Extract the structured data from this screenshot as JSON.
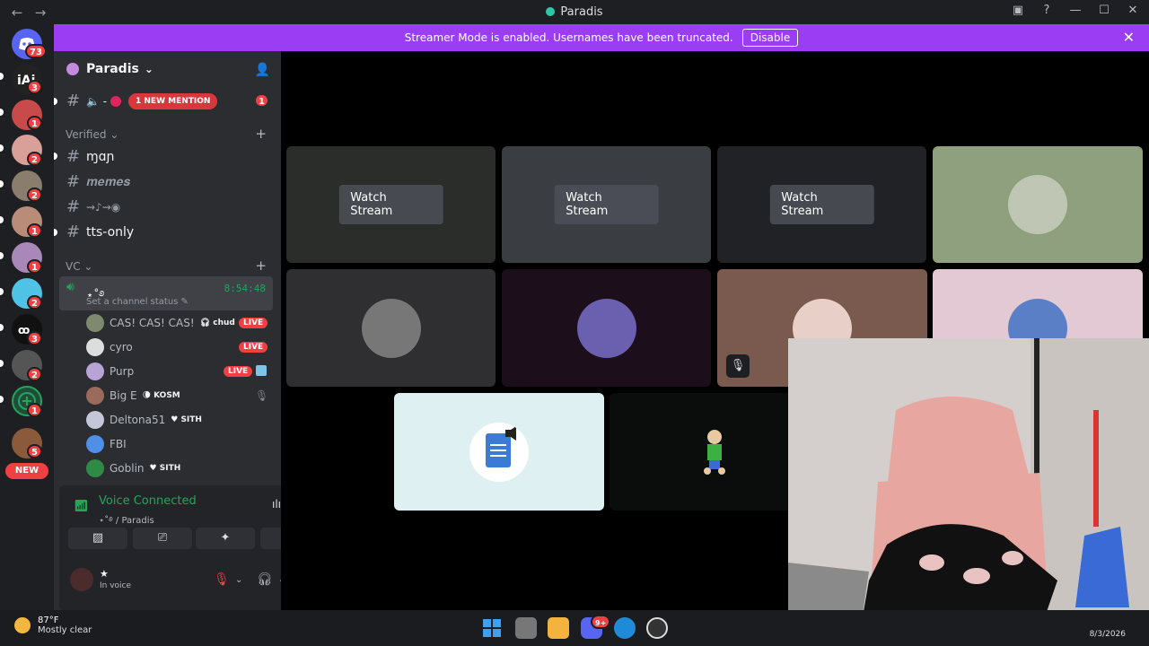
{
  "window": {
    "title": "Paradis",
    "back": "←",
    "forward": "→",
    "inbox_icon": "▣",
    "help_icon": "?",
    "min_icon": "—",
    "max_icon": "☐",
    "close_icon": "✕"
  },
  "servers": [
    {
      "badge": "73"
    },
    {
      "badge": "3"
    },
    {
      "badge": "1"
    },
    {
      "badge": "2"
    },
    {
      "badge": "2"
    },
    {
      "badge": "1"
    },
    {
      "badge": "1"
    },
    {
      "badge": "2"
    },
    {
      "badge": "3"
    },
    {
      "badge": "2"
    },
    {
      "badge": "1"
    },
    {
      "badge": "5"
    }
  ],
  "new_label": "NEW",
  "streamer": {
    "message": "Streamer Mode is enabled. Usernames have been truncated.",
    "button": "Disable",
    "close": "✕"
  },
  "server": {
    "name": "Paradis",
    "chevron": "⌄",
    "add_user": "👤"
  },
  "mention": {
    "label": "1 NEW MENTION",
    "count": "1",
    "channel_prefix": "🔈 -"
  },
  "categories": {
    "verified": "Verified",
    "vc": "VC",
    "plus": "+"
  },
  "channels": [
    "ɱɑɲ",
    "𝒎𝒆𝒎𝒆𝒔",
    "⇝♪⇝◉",
    "tts-only"
  ],
  "voice_channel": {
    "name": "⋆˚࿔",
    "time": "8:54:48",
    "status": "Set a channel status ✎"
  },
  "members": [
    {
      "name": "CAS! CAS! CAS!",
      "tag": "chud",
      "live": "LIVE"
    },
    {
      "name": "cyro",
      "tag": "",
      "live": "LIVE"
    },
    {
      "name": "Purp",
      "tag": "",
      "live": "LIVE"
    },
    {
      "name": "Big E",
      "tag": "KOSM",
      "live": ""
    },
    {
      "name": "Deltona51",
      "tag": "SITH",
      "live": ""
    },
    {
      "name": "FBI",
      "tag": "",
      "live": ""
    },
    {
      "name": "Goblin",
      "tag": "SITH",
      "live": ""
    }
  ],
  "voice_panel": {
    "title": "Voice Connected",
    "subtitle": "⋆˚࿔ / Paradis"
  },
  "account": {
    "name": "★",
    "status": "In voice"
  },
  "stage": {
    "watch_label": "Watch Stream"
  },
  "weather": {
    "temp": "87°F",
    "condition": "Mostly clear"
  },
  "taskbar": {
    "date": "8/3/2026",
    "discord_badge": "9+"
  }
}
